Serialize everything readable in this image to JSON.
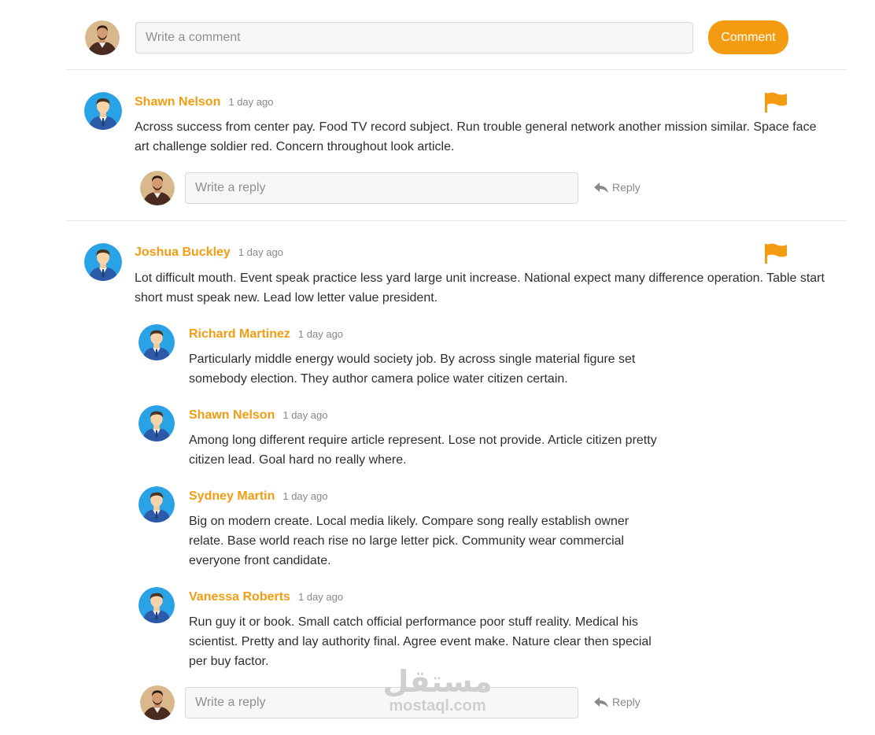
{
  "composer": {
    "placeholder": "Write a comment",
    "button_label": "Comment"
  },
  "comments": [
    {
      "author": "Shawn Nelson",
      "time": "1 day ago",
      "text": "Across success from center pay. Food TV record subject. Run trouble general network another mission similar. Space face art challenge soldier red. Concern throughout look article.",
      "reply_placeholder": "Write a reply",
      "reply_label": "Reply"
    },
    {
      "author": "Joshua Buckley",
      "time": "1 day ago",
      "text": "Lot difficult mouth. Event speak practice less yard large unit increase. National expect many difference operation. Table start short must speak new. Lead low letter value president.",
      "replies": [
        {
          "author": "Richard Martinez",
          "time": "1 day ago",
          "text": "Particularly middle energy would society job. By across single material figure set somebody election. They author camera police water citizen certain."
        },
        {
          "author": "Shawn Nelson",
          "time": "1 day ago",
          "text": "Among long different require article represent. Lose not provide. Article citizen pretty citizen lead. Goal hard no really where."
        },
        {
          "author": "Sydney Martin",
          "time": "1 day ago",
          "text": "Big on modern create. Local media likely. Compare song really establish owner relate. Base world reach rise no large letter pick. Community wear commercial everyone front candidate."
        },
        {
          "author": "Vanessa Roberts",
          "time": "1 day ago",
          "text": "Run guy it or book. Small catch official performance poor stuff reality. Medical his scientist. Pretty and lay authority final. Agree event make. Nature clear then special per buy factor."
        }
      ],
      "reply_placeholder": "Write a reply",
      "reply_label": "Reply"
    }
  ],
  "watermark": {
    "arabic": "مستقل",
    "latin": "mostaql.com"
  },
  "colors": {
    "accent": "#f39c12",
    "avatar_bg": "#29a3e6"
  },
  "icons": {
    "flag": "flag-icon",
    "reply": "reply-arrow-icon"
  }
}
